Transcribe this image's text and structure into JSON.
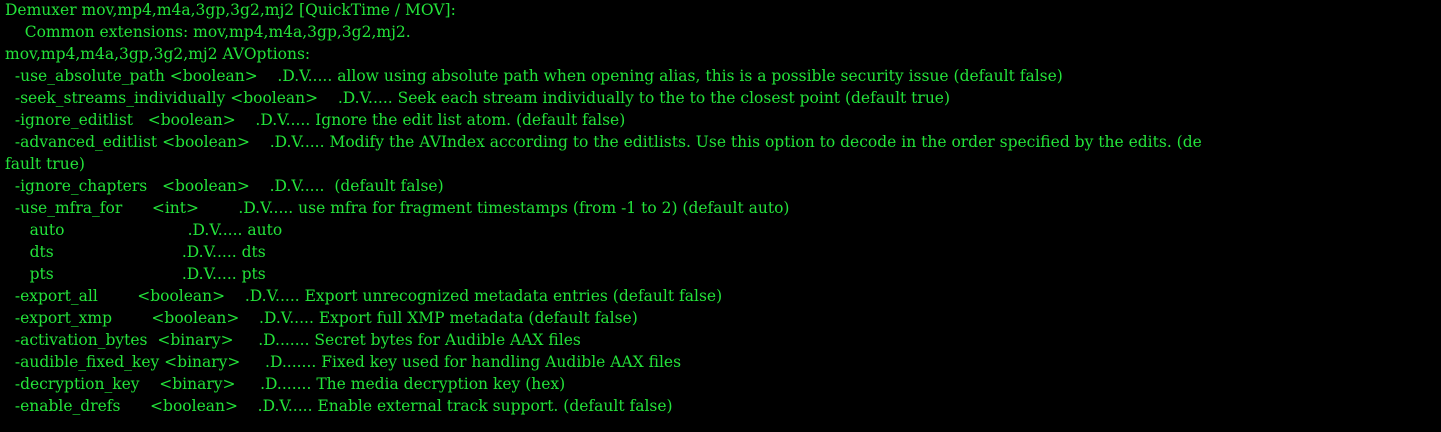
{
  "colors": {
    "background": "#000000",
    "text": "#23e23a"
  },
  "terminal": {
    "lines": [
      "Demuxer mov,mp4,m4a,3gp,3g2,mj2 [QuickTime / MOV]:",
      "    Common extensions: mov,mp4,m4a,3gp,3g2,mj2.",
      "mov,mp4,m4a,3gp,3g2,mj2 AVOptions:",
      "  -use_absolute_path <boolean>    .D.V..... allow using absolute path when opening alias, this is a possible security issue (default false)",
      "  -seek_streams_individually <boolean>    .D.V..... Seek each stream individually to the to the closest point (default true)",
      "  -ignore_editlist   <boolean>    .D.V..... Ignore the edit list atom. (default false)",
      "  -advanced_editlist <boolean>    .D.V..... Modify the AVIndex according to the editlists. Use this option to decode in the order specified by the edits. (de",
      "fault true)",
      "  -ignore_chapters   <boolean>    .D.V.....  (default false)",
      "  -use_mfra_for      <int>        .D.V..... use mfra for fragment timestamps (from -1 to 2) (default auto)",
      "     auto                         .D.V..... auto",
      "     dts                          .D.V..... dts",
      "     pts                          .D.V..... pts",
      "  -export_all        <boolean>    .D.V..... Export unrecognized metadata entries (default false)",
      "  -export_xmp        <boolean>    .D.V..... Export full XMP metadata (default false)",
      "  -activation_bytes  <binary>     .D....... Secret bytes for Audible AAX files",
      "  -audible_fixed_key <binary>     .D....... Fixed key used for handling Audible AAX files",
      "  -decryption_key    <binary>     .D....... The media decryption key (hex)",
      "  -enable_drefs      <boolean>    .D.V..... Enable external track support. (default false)"
    ]
  }
}
